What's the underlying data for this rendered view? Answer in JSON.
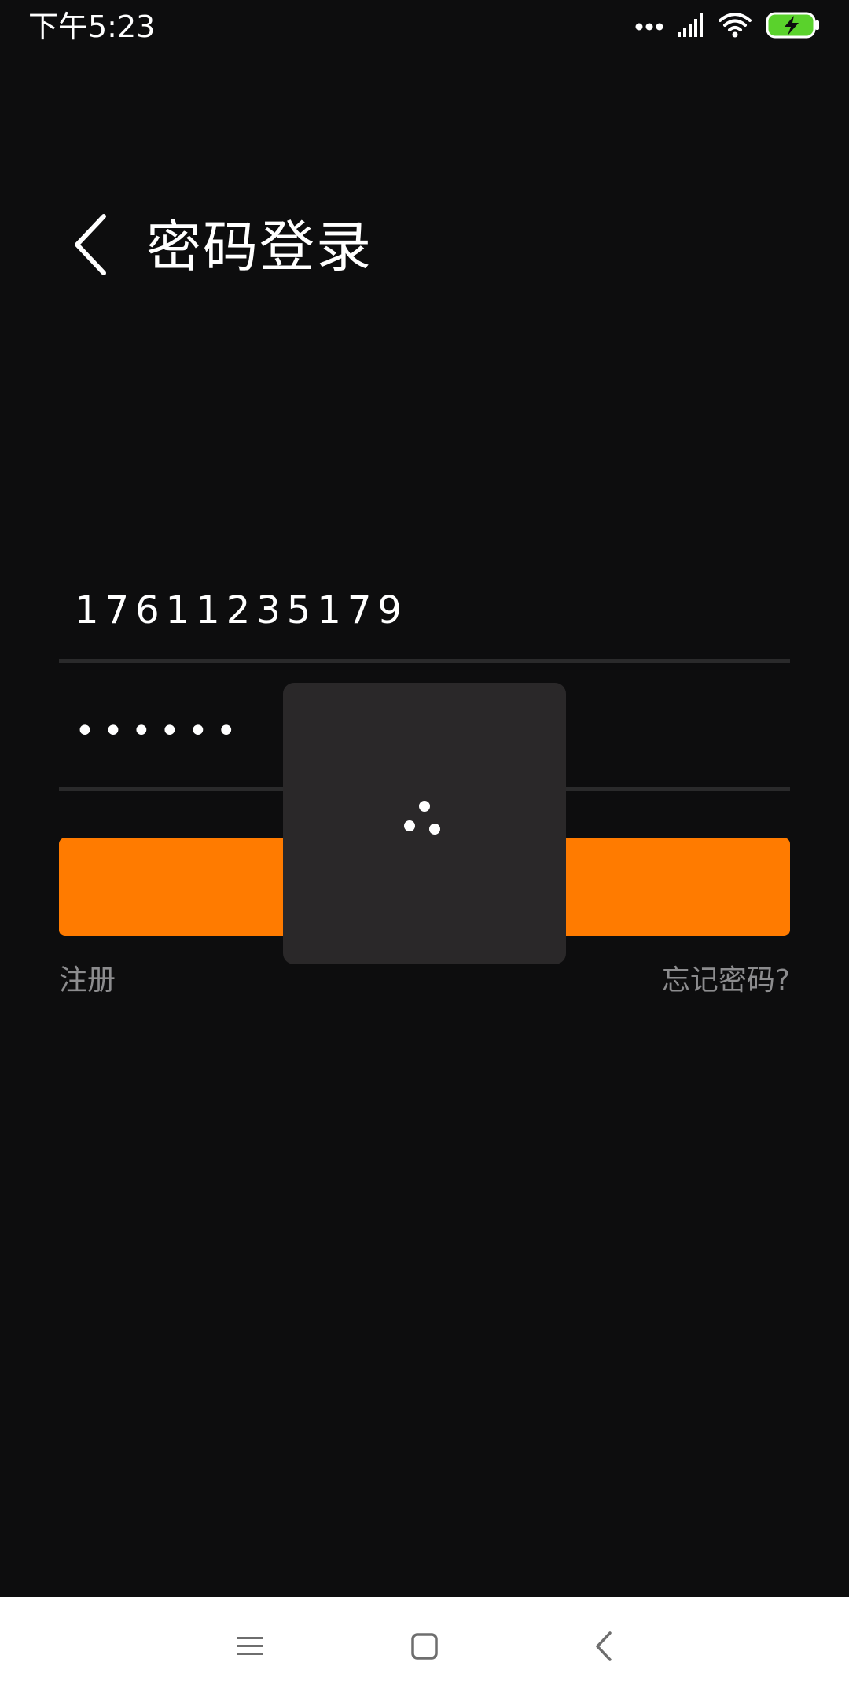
{
  "status_bar": {
    "time": "下午5:23",
    "icons": [
      "more-dots-icon",
      "signal-icon",
      "wifi-icon",
      "battery-charging-icon"
    ],
    "battery_color": "#5ad22c"
  },
  "header": {
    "back_icon": "chevron-left-icon",
    "title": "密码登录"
  },
  "form": {
    "phone_value": "17611235179",
    "password_value": "••••••",
    "login_button_label": "",
    "register_link": "注册",
    "forgot_link": "忘记密码?"
  },
  "loading": {
    "icon": "loading-spinner-icon"
  },
  "nav_bar": {
    "buttons": [
      "menu-icon",
      "home-icon",
      "back-icon"
    ]
  },
  "colors": {
    "background": "#0d0d0e",
    "accent": "#ff7b00",
    "link": "#8c8c8e",
    "overlay": "#2a2829"
  }
}
